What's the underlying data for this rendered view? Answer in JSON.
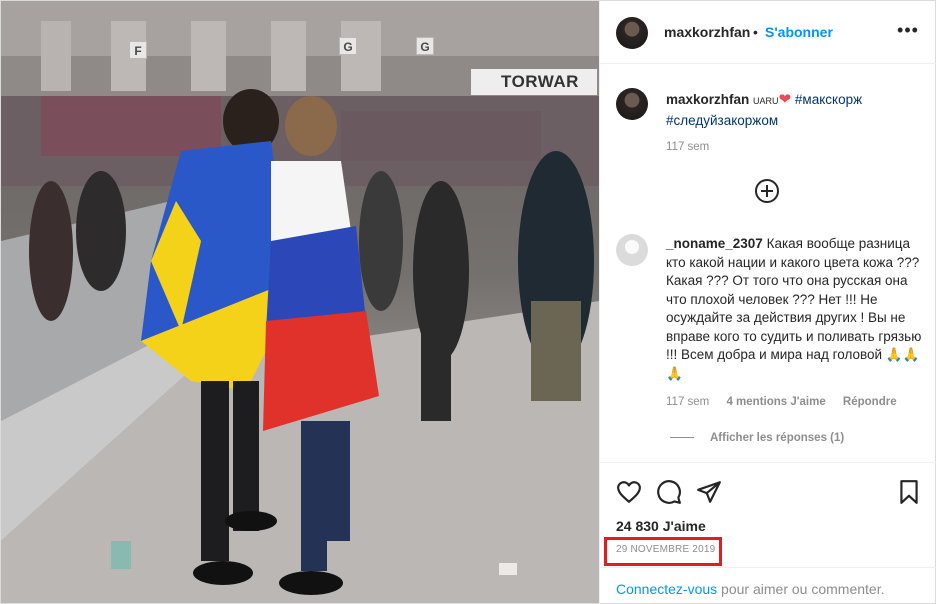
{
  "photo": {
    "alt_signs": [
      "F",
      "G",
      "G",
      "TORWAR"
    ]
  },
  "header": {
    "username": "maxkorzhfan",
    "separator": "•",
    "follow_label": "S'abonner",
    "more_label": "•••"
  },
  "caption": {
    "username": "maxkorzhfan",
    "flag_text": "UARU",
    "heart": "❤",
    "tag1": "#макскорж",
    "tag2": "#следуйзакоржом",
    "time": "117 sem"
  },
  "comment": {
    "username": "_noname_2307",
    "text": "Какая вообще разница кто какой нации и какого цвета кожа ??? Какая ??? От того что она русская она что плохой человек ??? Нет !!! Не осуждайте за действия других ! Вы не вправе кого то судить и поливать грязью !!! Всем добра и мира над головой 🙏🙏🙏",
    "time": "117 sem",
    "likes": "4 mentions J'aime",
    "reply": "Répondre",
    "show_replies": "Afficher les réponses (1)"
  },
  "stats": {
    "likes": "24 830 J'aime",
    "date": "29 NOVEMBRE 2019"
  },
  "login": {
    "link": "Connectez-vous",
    "rest": " pour aimer ou commenter."
  },
  "icons": {
    "like": "heart-icon",
    "comment": "comment-icon",
    "share": "share-icon",
    "save": "bookmark-icon",
    "more": "more-icon",
    "load_more": "plus-circle-icon"
  },
  "colors": {
    "link_blue": "#0095f6",
    "hashtag": "#00376b",
    "muted": "#8e8e8e",
    "highlight_red": "#e01e1e",
    "heart_red": "#ed4956"
  }
}
